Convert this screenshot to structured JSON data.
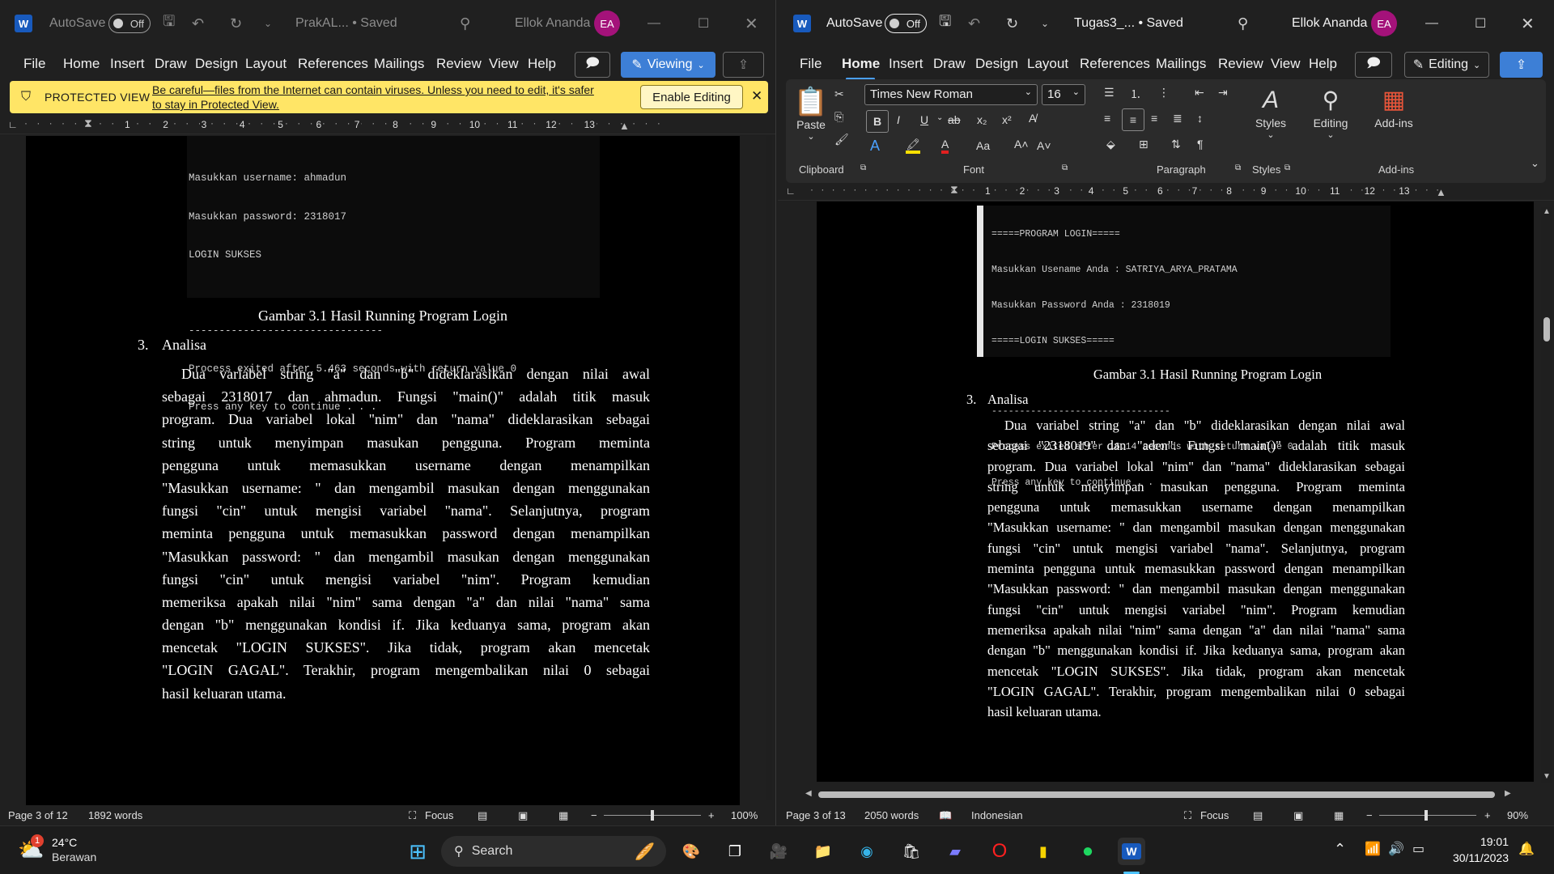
{
  "left_window": {
    "autosave_label": "AutoSave",
    "autosave_state": "Off",
    "file_title": "PrakAL... • Saved",
    "user_name": "Ellok Ananda",
    "user_initials": "EA",
    "menu": [
      "File",
      "Home",
      "Insert",
      "Draw",
      "Design",
      "Layout",
      "References",
      "Mailings",
      "Review",
      "View",
      "Help"
    ],
    "mode_label": "Viewing",
    "protected_title": "PROTECTED VIEW",
    "protected_msg_1": "Be careful—files from the Internet can contain viruses. Unless you need to edit, it's safer",
    "protected_msg_2": "to stay in Protected View.",
    "enable_editing": "Enable Editing",
    "ruler_ticks": [
      "1",
      "2",
      "3",
      "4",
      "5",
      "6",
      "7",
      "8",
      "9",
      "10",
      "11",
      "12",
      "13"
    ],
    "console_lines": [
      "Masukkan username: ahmadun",
      "Masukkan password: 2318017",
      "LOGIN SUKSES",
      "",
      "--------------------------------",
      "Process exited after 5.463 seconds with return value 0",
      "Press any key to continue . . ."
    ],
    "caption": "Gambar 3.1 Hasil Running Program Login",
    "heading_number": "3.",
    "heading": "Analisa",
    "lines": [
      "Dua variabel string \"a\" dan \"b\" dideklarasikan dengan nilai awal",
      "sebagai 2318017 dan ahmadun. Fungsi \"main()\" adalah titik masuk",
      "program. Dua variabel lokal \"nim\" dan \"nama\" dideklarasikan sebagai",
      "string untuk menyimpan masukan pengguna. Program meminta",
      "pengguna untuk memasukkan username dengan menampilkan",
      "\"Masukkan username: \" dan mengambil masukan dengan menggunakan",
      "fungsi \"cin\" untuk mengisi variabel \"nama\". Selanjutnya, program",
      "meminta pengguna untuk memasukkan password dengan menampilkan",
      "\"Masukkan password: \" dan mengambil masukan dengan menggunakan",
      "fungsi \"cin\" untuk mengisi variabel \"nim\". Program kemudian",
      "memeriksa apakah nilai \"nim\" sama dengan \"a\" dan nilai \"nama\" sama",
      "dengan \"b\" menggunakan kondisi if. Jika keduanya sama, program akan",
      "mencetak \"LOGIN SUKSES\". Jika tidak, program akan mencetak",
      "\"LOGIN GAGAL\". Terakhir, program mengembalikan nilai 0 sebagai",
      "hasil keluaran utama."
    ],
    "status_page": "Page 3 of 12",
    "status_words": "1892 words",
    "status_focus": "Focus",
    "zoom": "100%"
  },
  "right_window": {
    "autosave_label": "AutoSave",
    "autosave_state": "Off",
    "file_title": "Tugas3_... • Saved",
    "user_name": "Ellok Ananda",
    "user_initials": "EA",
    "menu": [
      "File",
      "Home",
      "Insert",
      "Draw",
      "Design",
      "Layout",
      "References",
      "Mailings",
      "Review",
      "View",
      "Help"
    ],
    "mode_label": "Editing",
    "font_name": "Times New Roman",
    "font_size": "16",
    "paste_label": "Paste",
    "styles_label": "Styles",
    "editing_label": "Editing",
    "addins_label": "Add-ins",
    "groups": [
      "Clipboard",
      "Font",
      "Paragraph",
      "Styles",
      "Add-ins"
    ],
    "ruler_ticks": [
      "1",
      "2",
      "3",
      "4",
      "5",
      "6",
      "7",
      "8",
      "9",
      "10",
      "11",
      "12",
      "13"
    ],
    "console_lines": [
      "=====PROGRAM LOGIN=====",
      "Masukkan Usename Anda : SATRIYA_ARYA_PRATAMA",
      "Masukkan Password Anda : 2318019",
      "=====LOGIN SUKSES=====",
      "",
      "--------------------------------",
      "Process exited after 16.14 seconds with return value 0",
      "Press any key to continue . . ."
    ],
    "caption": "Gambar 3.1 Hasil Running Program Login",
    "heading_number": "3.",
    "heading": "Analisa",
    "lines": [
      "Dua variabel string \"a\" dan \"b\" dideklarasikan dengan nilai awal",
      "sebagai \"2318019\" dan \"aden\". Fungsi \"main()\" adalah titik masuk",
      "program. Dua variabel lokal \"nim\" dan \"nama\" dideklarasikan sebagai",
      "string untuk menyimpan masukan pengguna. Program meminta",
      "pengguna untuk memasukkan username dengan menampilkan",
      "\"Masukkan username: \" dan mengambil masukan dengan menggunakan",
      "fungsi \"cin\" untuk mengisi variabel \"nama\". Selanjutnya, program",
      "meminta pengguna untuk memasukkan password dengan menampilkan",
      "\"Masukkan password: \" dan mengambil masukan dengan menggunakan",
      "fungsi \"cin\" untuk mengisi variabel \"nim\". Program kemudian",
      "memeriksa apakah nilai \"nim\" sama dengan \"a\" dan nilai \"nama\" sama",
      "dengan \"b\" menggunakan kondisi if. Jika keduanya sama, program akan",
      "mencetak \"LOGIN SUKSES\". Jika tidak, program akan mencetak",
      "\"LOGIN GAGAL\". Terakhir, program mengembalikan nilai 0 sebagai",
      "hasil keluaran utama."
    ],
    "status_page": "Page 3 of 13",
    "status_words": "2050 words",
    "status_lang": "Indonesian",
    "status_focus": "Focus",
    "zoom": "90%"
  },
  "taskbar": {
    "weather_temp": "24°C",
    "weather_desc": "Berawan",
    "weather_badge": "1",
    "search_label": "Search",
    "time": "19:01",
    "date": "30/11/2023"
  }
}
